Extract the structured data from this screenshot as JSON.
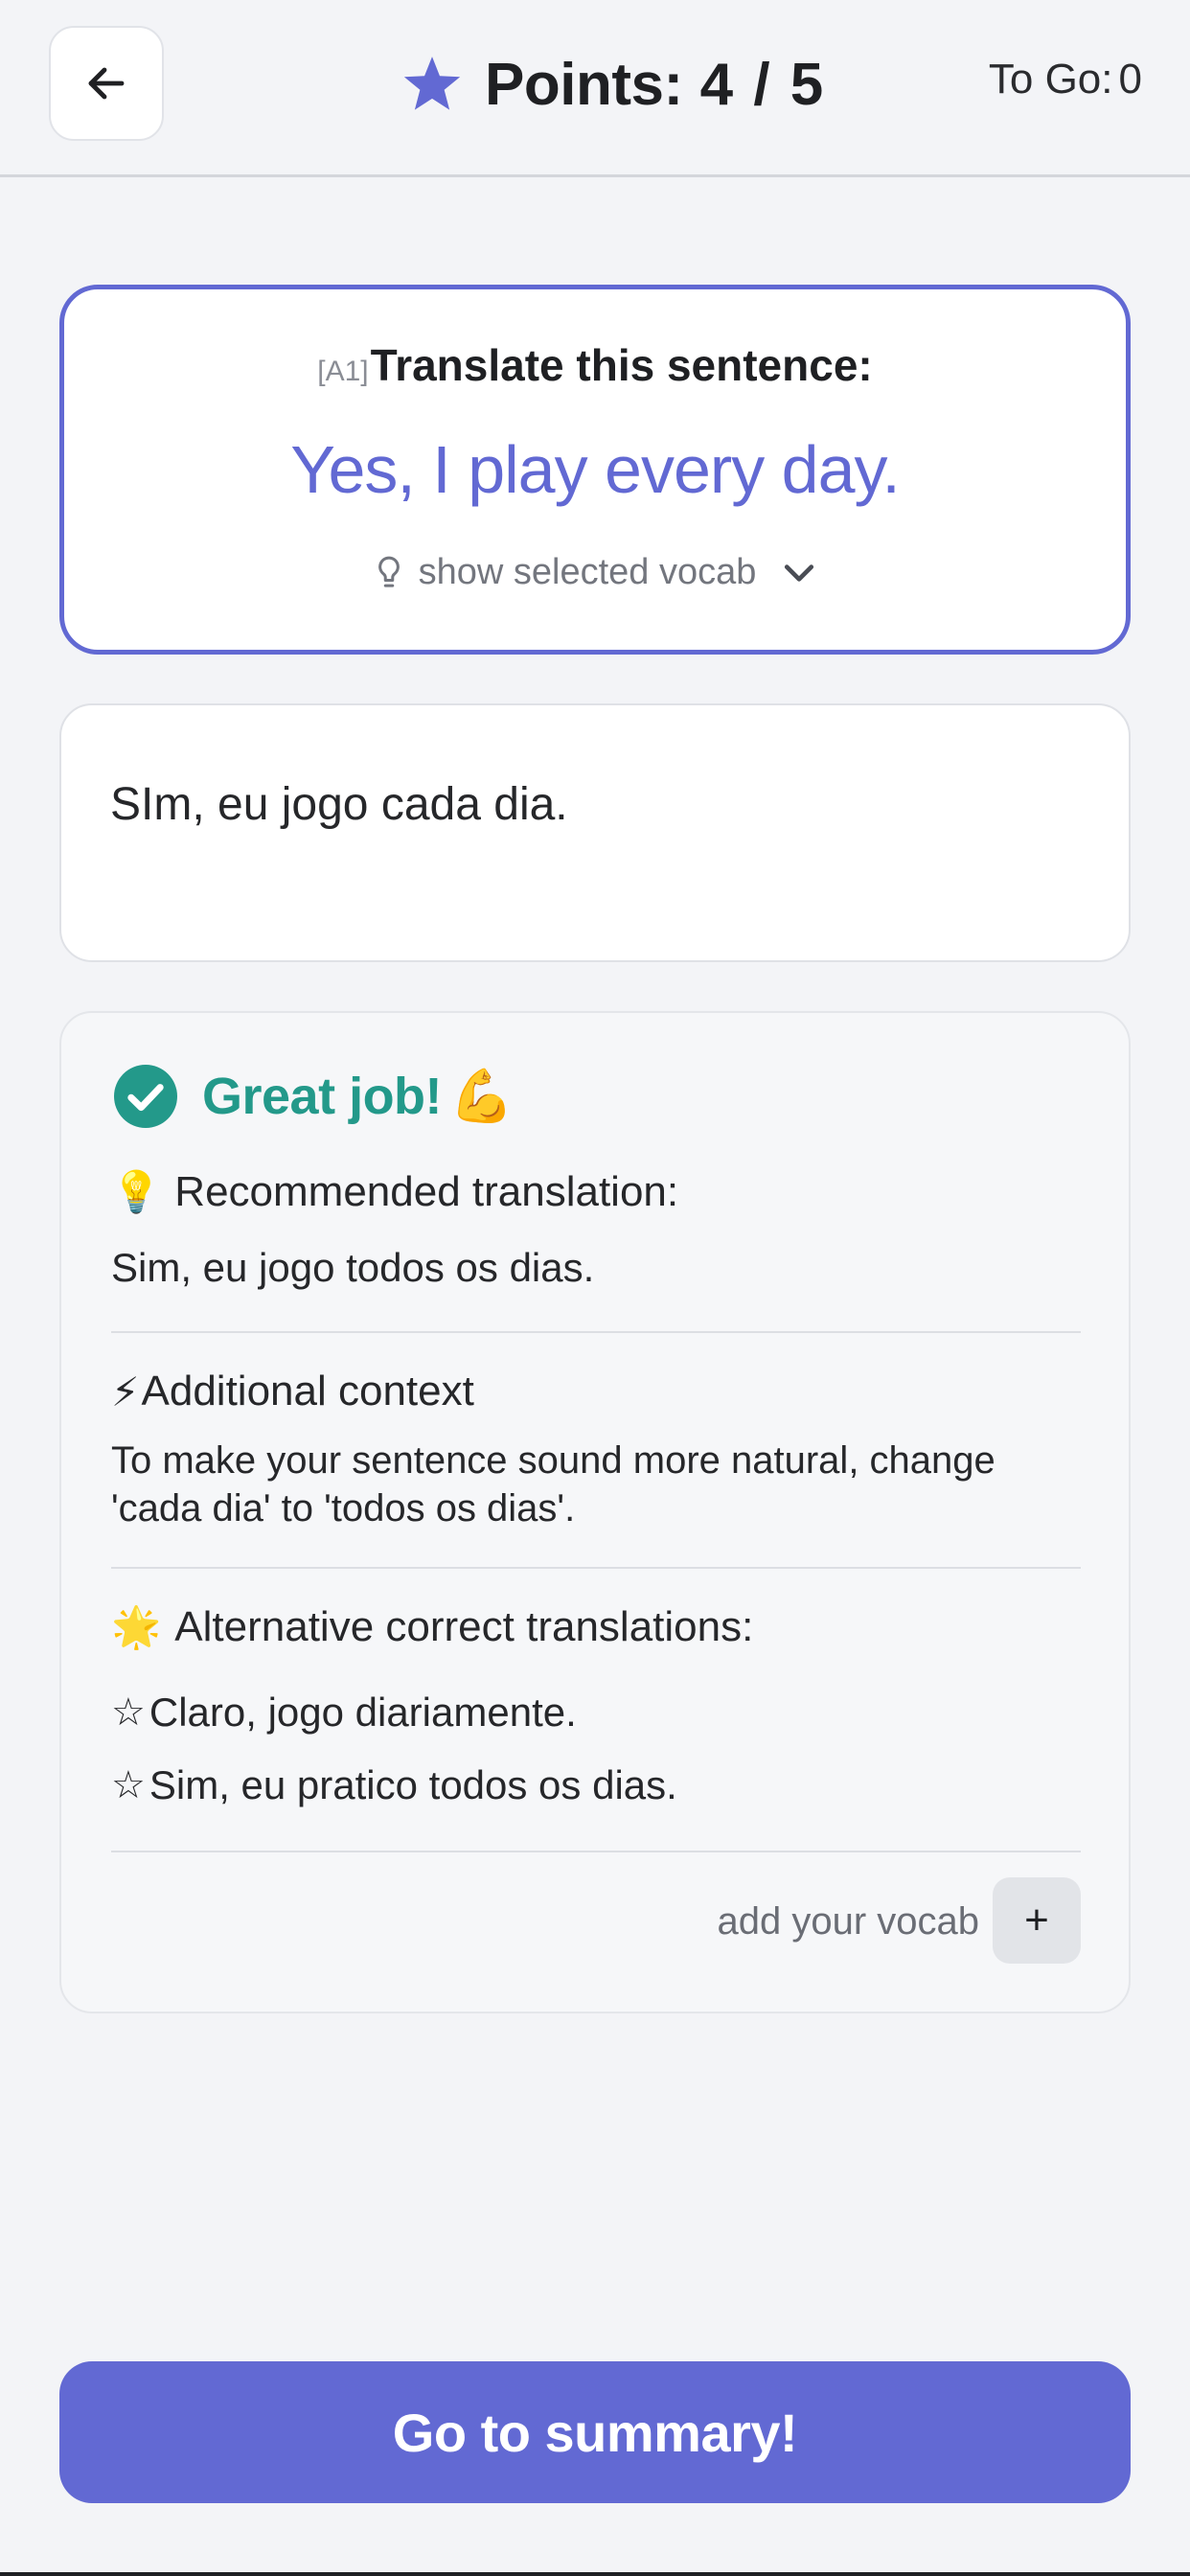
{
  "header": {
    "back_icon": "arrow-left-icon",
    "star_icon": "star-icon",
    "points_label": "Points:",
    "points_value": "4 / 5",
    "togo_label": "To Go:",
    "togo_value": "0"
  },
  "question": {
    "level": "[A1]",
    "prompt": "Translate this sentence:",
    "sentence": "Yes, I play every day.",
    "vocab_toggle_label": "show selected vocab"
  },
  "answer": {
    "text": "SIm, eu jogo cada dia."
  },
  "feedback": {
    "status": "Great job!",
    "status_emoji": "💪",
    "recommended_emoji": "💡",
    "recommended_title": "Recommended translation:",
    "recommended_text": "Sim, eu jogo todos os dias.",
    "context_emoji": "⚡",
    "context_title": "Additional context",
    "context_text": "To make your sentence sound more natural, change 'cada dia' to 'todos os dias'.",
    "alternatives_emoji": "🌟",
    "alternatives_title": "Alternative correct translations:",
    "alternative_marker": "☆",
    "alternatives": [
      "Claro, jogo diariamente.",
      "Sim, eu pratico todos os dias."
    ],
    "add_vocab_label": "add your vocab",
    "add_button_label": "+"
  },
  "actions": {
    "summary_label": "Go to summary!"
  },
  "colors": {
    "accent": "#6269d3",
    "success": "#23998a",
    "background": "#f3f4f7"
  }
}
